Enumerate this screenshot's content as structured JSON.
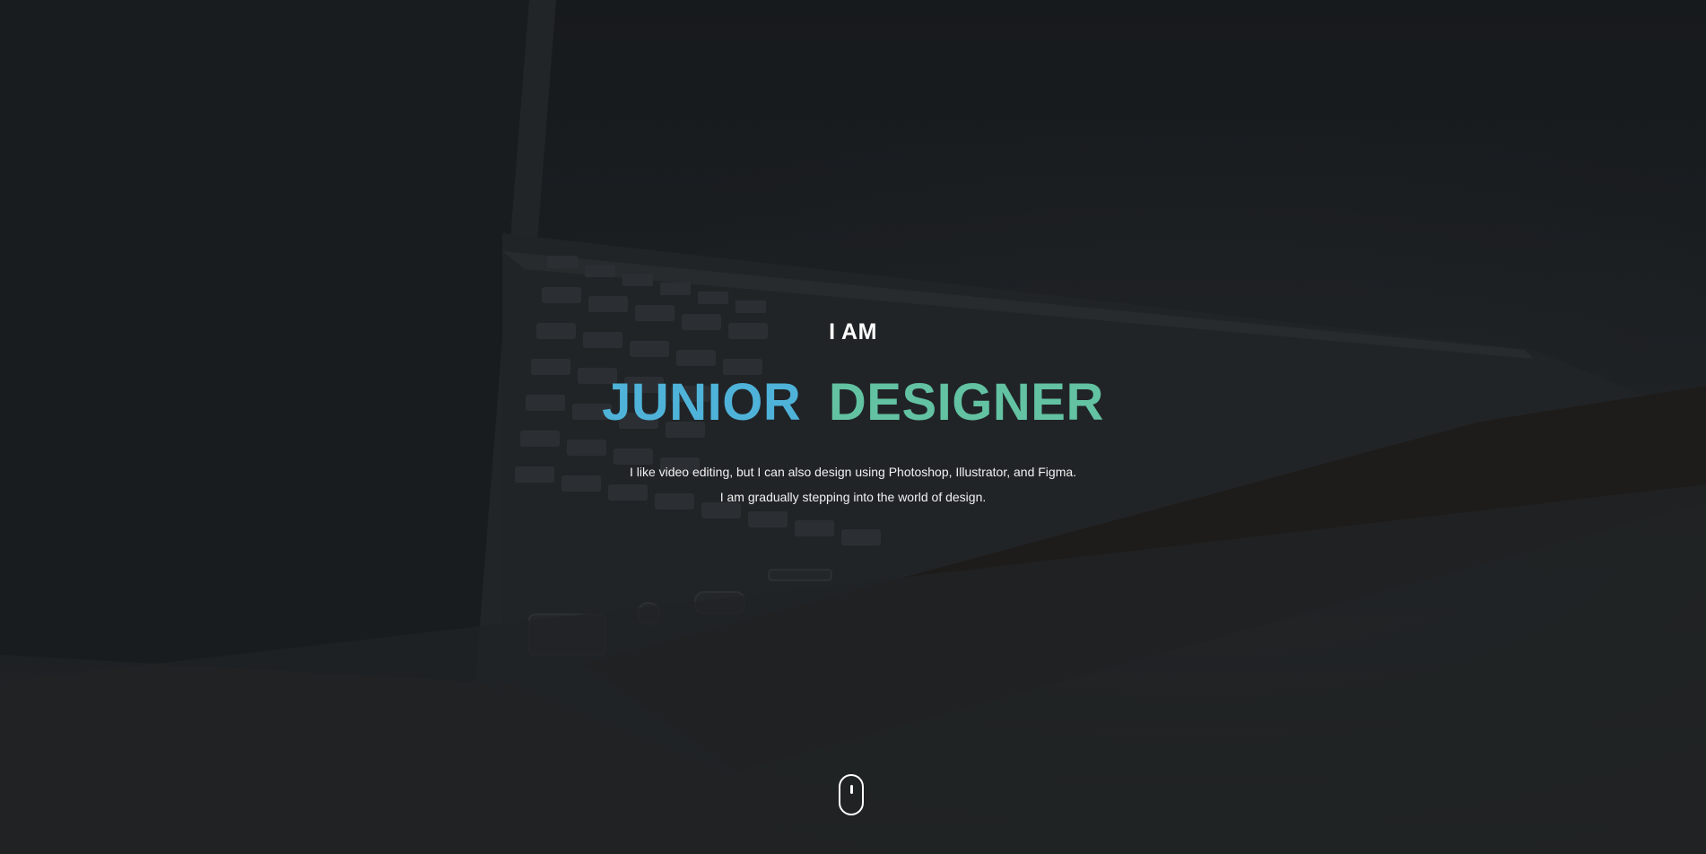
{
  "hero": {
    "kicker": "I AM",
    "title_word1": "JUNIOR",
    "title_word2": "DESIGNER",
    "desc_line1": "I like video editing, but I can also design using Photoshop, Illustrator, and Figma.",
    "desc_line2": "I am gradually stepping into the world of design."
  },
  "colors": {
    "accent_blue": "#4fb3d9",
    "accent_green": "#62c2a2",
    "text": "#ffffff",
    "background": "#1c1f22"
  },
  "icons": {
    "scroll_indicator": "mouse-scroll-icon"
  }
}
